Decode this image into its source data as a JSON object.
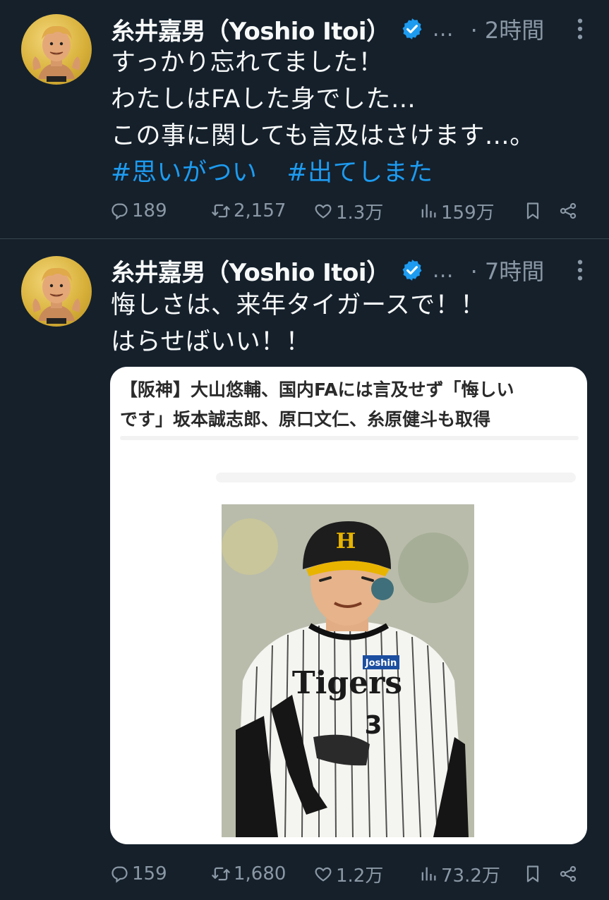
{
  "tweets": [
    {
      "author_name": "糸井嘉男（Yoshio Itoi）",
      "handle_ellipsis": "…",
      "time": "· 2時間",
      "lines": [
        "すっかり忘れてました！",
        "わたしはFAした身でした…",
        "この事に関しても言及はさけます…。"
      ],
      "hashtags": [
        "#思いがつい",
        "#出てしまた"
      ],
      "stats": {
        "replies": "189",
        "retweets": "2,157",
        "likes": "1.3万",
        "views": "159万"
      }
    },
    {
      "author_name": "糸井嘉男（Yoshio Itoi）",
      "handle_ellipsis": "…",
      "time": "· 7時間",
      "lines": [
        "悔しさは、来年タイガースで！！",
        "はらせばいい！！"
      ],
      "card": {
        "title_line1": "【阪神】大山悠輔、国内FAには言及せず「悔しい",
        "title_line2": "です」坂本誠志郎、原口文仁、糸原健斗も取得",
        "photo_text": {
          "helmet": "H",
          "jersey": "Tigers",
          "number": "3",
          "sponsor": "Joshin"
        }
      },
      "stats": {
        "replies": "159",
        "retweets": "1,680",
        "likes": "1.2万",
        "views": "73.2万"
      }
    }
  ],
  "icons": [
    "avatar",
    "verified-badge-icon",
    "more-icon",
    "reply-icon",
    "retweet-icon",
    "like-icon",
    "views-icon",
    "bookmark-icon",
    "share-icon"
  ],
  "colors": {
    "background": "#15202b",
    "text": "#f7f9f9",
    "muted": "#8b98a5",
    "link": "#1d9bf0",
    "verified": "#1d9bf0"
  }
}
